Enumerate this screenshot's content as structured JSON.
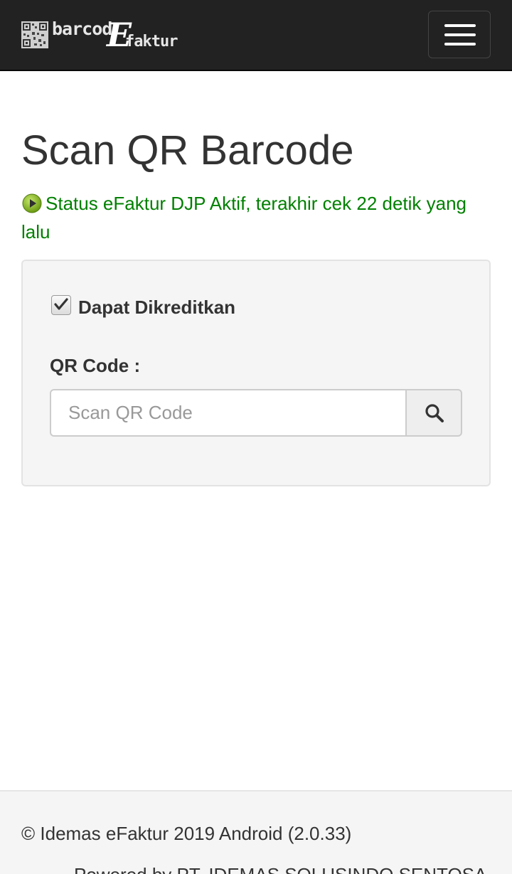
{
  "navbar": {
    "brand": {
      "part1": "barcod",
      "part2": "E",
      "part3": "faktur"
    },
    "menu_icon": "hamburger-menu-icon"
  },
  "page": {
    "title": "Scan QR Barcode",
    "status_icon": "play-circle-icon",
    "status_text": "Status eFaktur DJP Aktif, terakhir cek 22 detik yang lalu",
    "status_color": "#008000"
  },
  "form": {
    "checkbox_label": "Dapat Dikreditkan",
    "checkbox_checked": true,
    "qr_label": "QR Code :",
    "qr_value": "",
    "qr_placeholder": "Scan QR Code",
    "search_icon": "search-icon"
  },
  "footer": {
    "copyright": "© Idemas eFaktur 2019 Android (2.0.33)",
    "powered": "Powered by PT. IDEMAS SOLUSINDO SENTOSA"
  }
}
